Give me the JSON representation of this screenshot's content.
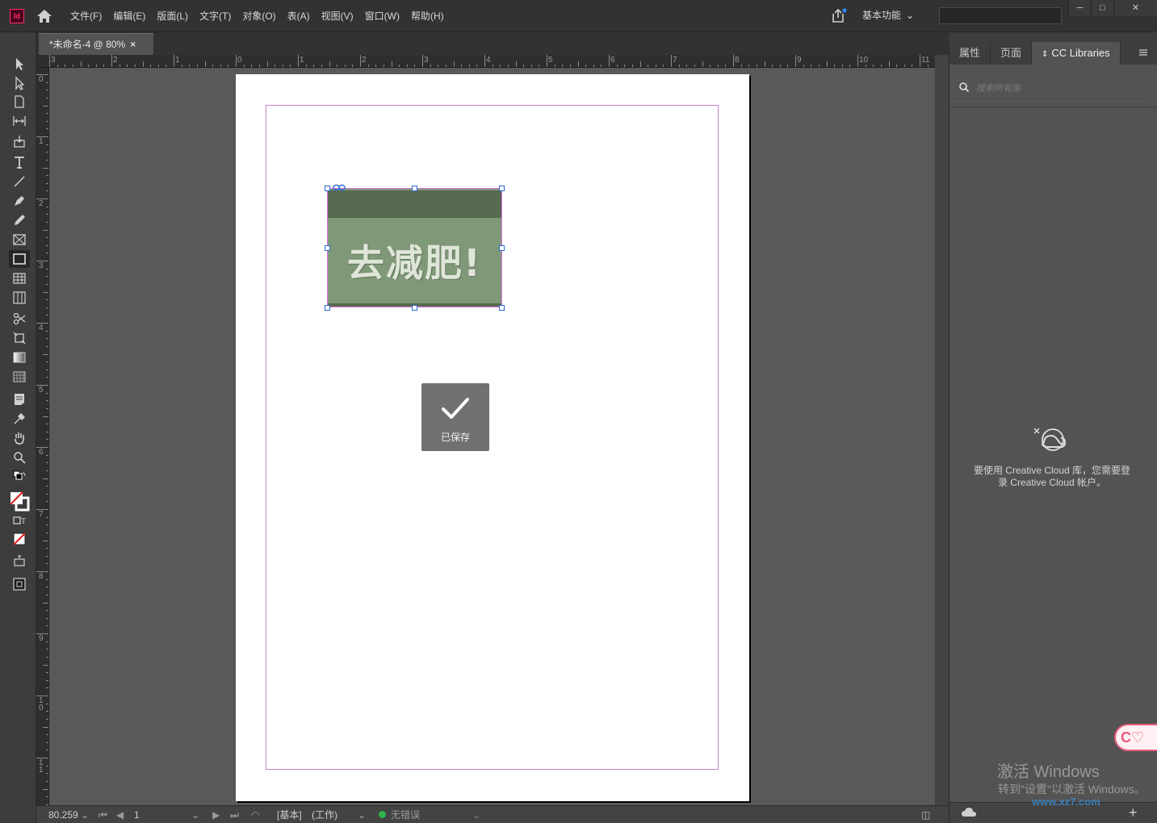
{
  "app": {
    "logo": "Id",
    "workspace": "基本功能"
  },
  "menu": [
    "文件(F)",
    "编辑(E)",
    "版面(L)",
    "文字(T)",
    "对象(O)",
    "表(A)",
    "视图(V)",
    "窗口(W)",
    "帮助(H)"
  ],
  "window_controls": [
    "─",
    "□",
    "✕"
  ],
  "document_tab": {
    "title": "*未命名-4 @ 80%",
    "close": "×"
  },
  "rulers": {
    "horizontal": [
      "3",
      "2",
      "1",
      "0",
      "1",
      "2",
      "3",
      "4",
      "5",
      "6",
      "7",
      "8",
      "9",
      "10",
      "11"
    ],
    "vertical": [
      "0",
      "1",
      "2",
      "3",
      "4",
      "5",
      "6",
      "7",
      "8",
      "9",
      "1\n0",
      "1\n1"
    ]
  },
  "image": {
    "text": "去减肥!"
  },
  "toast": {
    "label": "已保存",
    "icon": "checkmark-icon"
  },
  "statusbar": {
    "zoom": "80.259",
    "page": "1",
    "layout": "[基本]",
    "state": "(工作)",
    "errors": "无错误"
  },
  "panel": {
    "tabs": [
      "属性",
      "页面",
      "CC Libraries"
    ],
    "active_tab": "CC Libraries",
    "search_placeholder": "搜索所有库",
    "message_line1": "要使用 Creative Cloud 库，您需要登",
    "message_line2": "录 Creative Cloud 帐户。"
  },
  "watermark": {
    "line1": "激活 Windows",
    "line2": "转到\"设置\"以激活 Windows。",
    "site": "www.xz7.com"
  },
  "colors": {
    "accent": "#2a6ad4",
    "app_logo": "#ff3366",
    "margin_guide": "#c882c8",
    "image_bg": "#7f9878"
  }
}
